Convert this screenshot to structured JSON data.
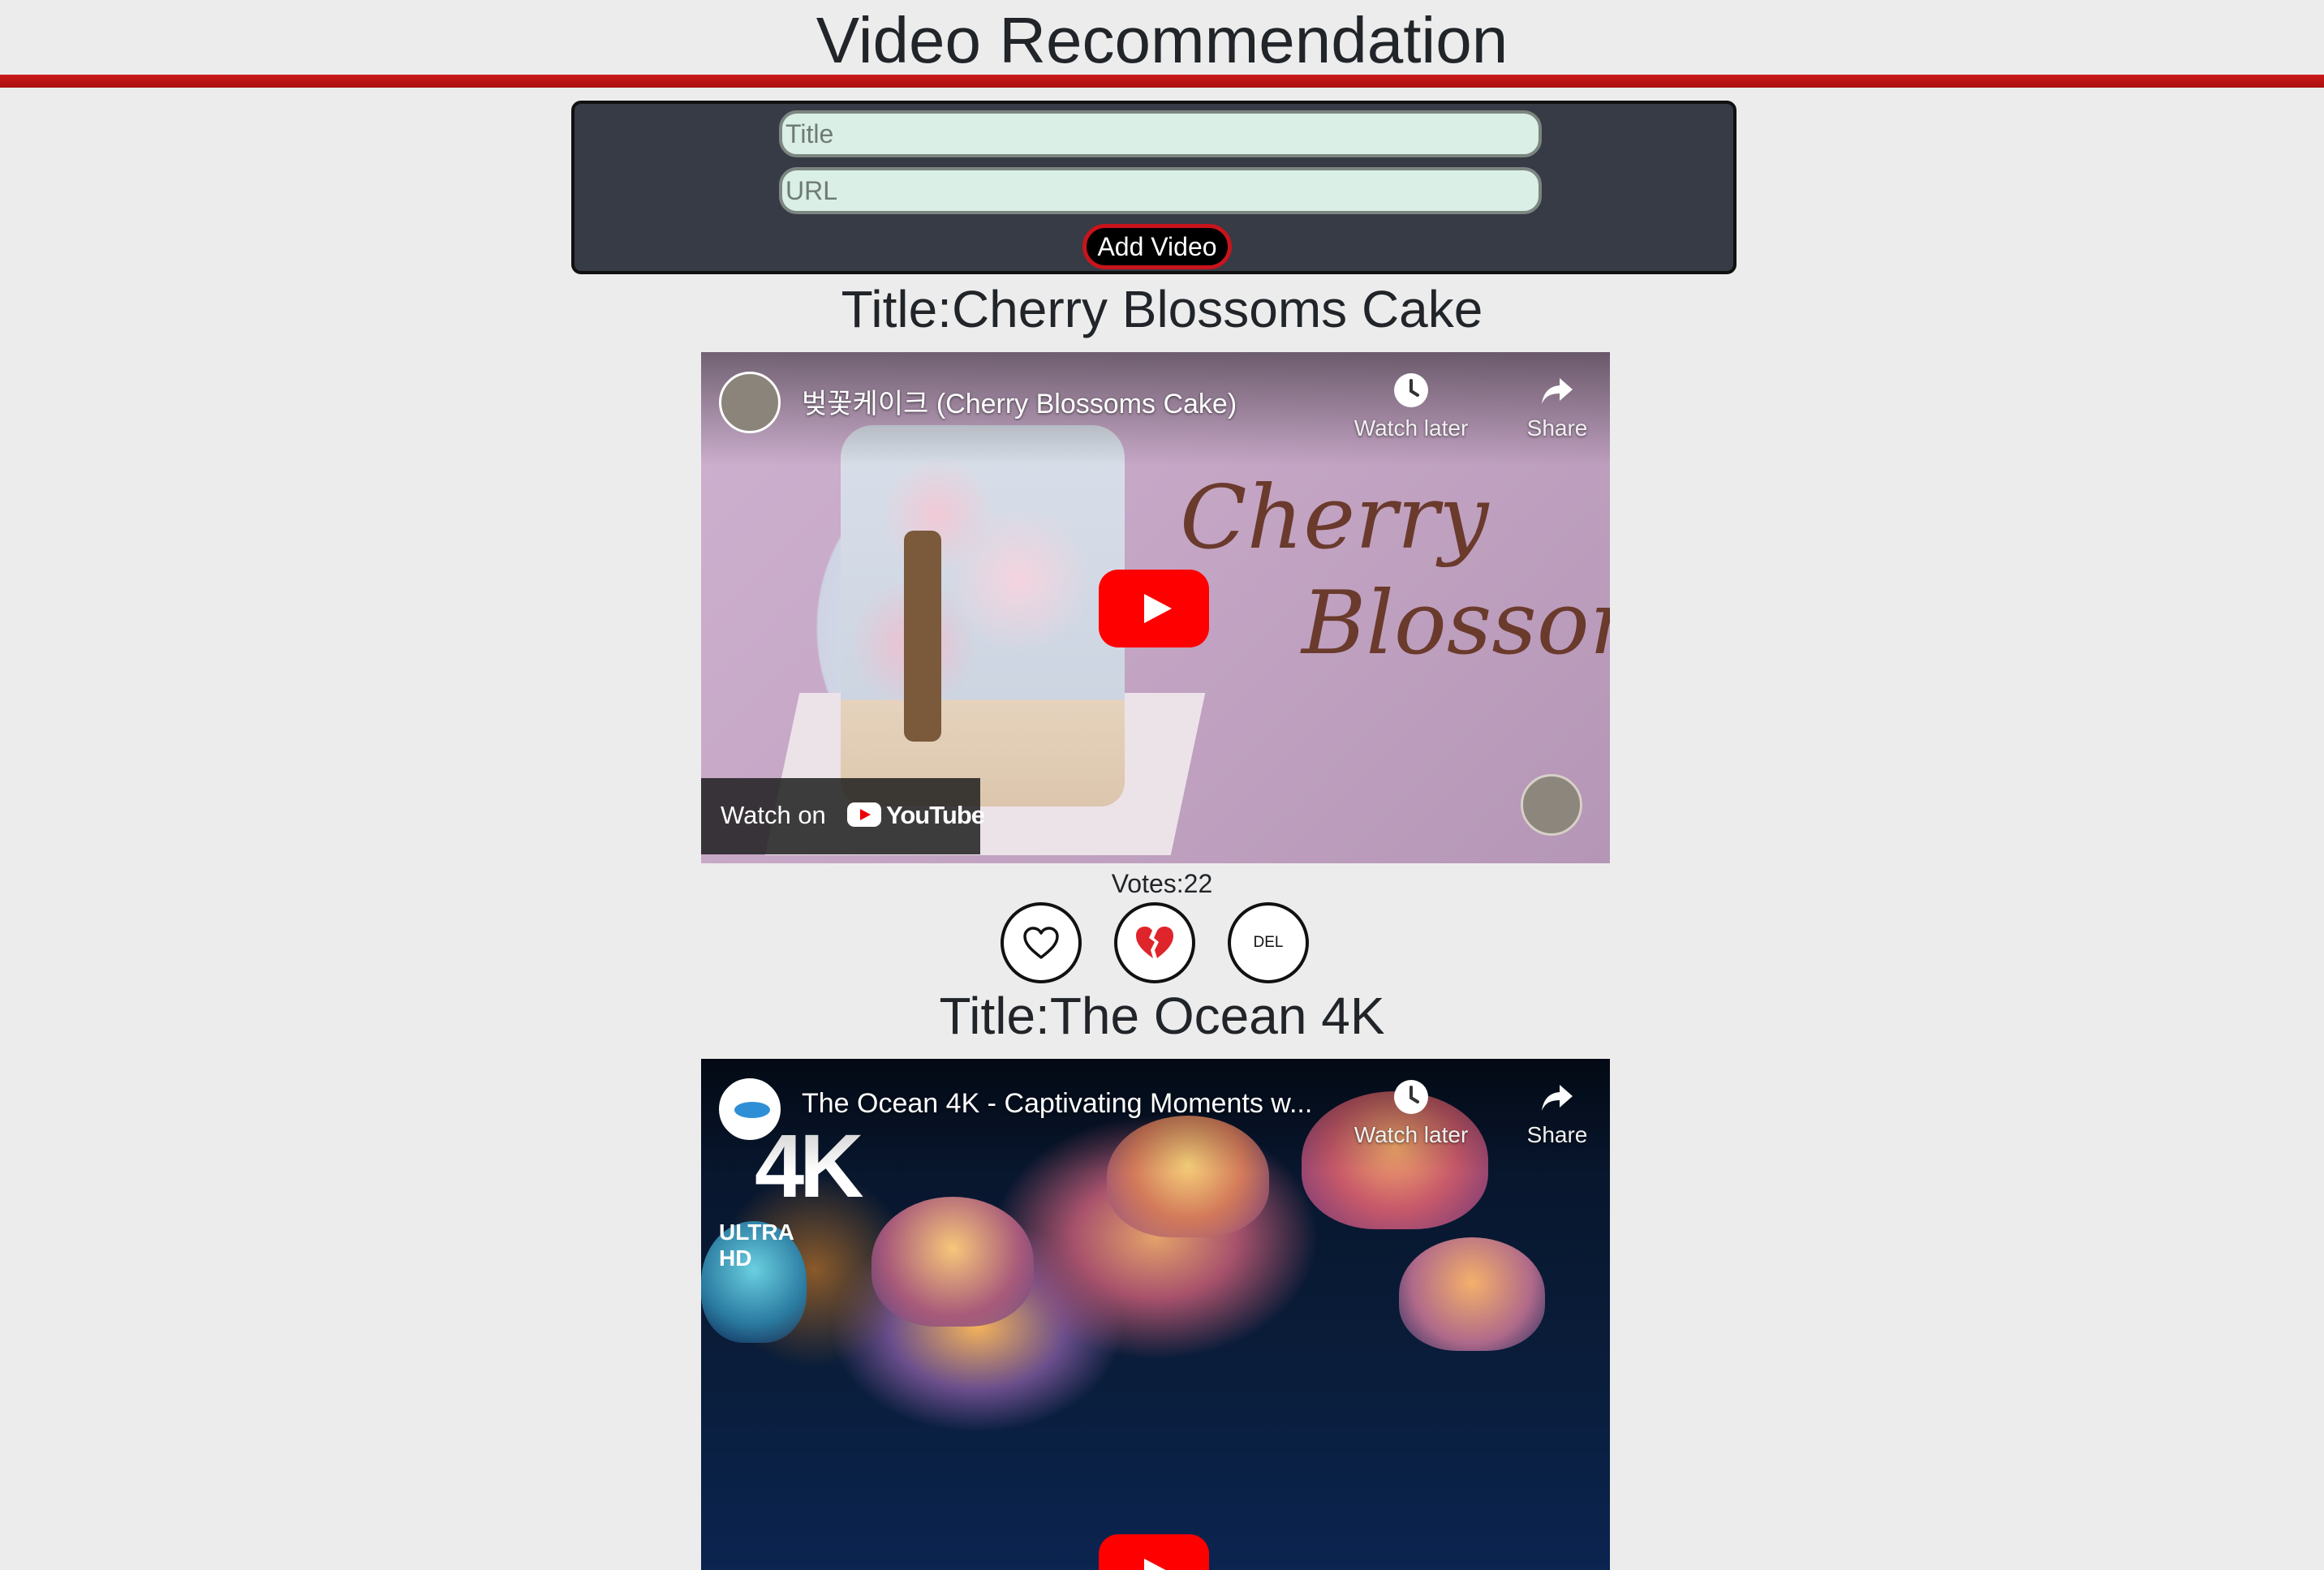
{
  "header": {
    "title": "Video Recommendation"
  },
  "form": {
    "title_placeholder": "Title",
    "url_placeholder": "URL",
    "add_label": "Add Video"
  },
  "videos": [
    {
      "heading": "Title:Cherry Blossoms Cake",
      "player": {
        "caption": "벚꽃케이크 (Cherry Blossoms Cake)",
        "watch_later": "Watch later",
        "share": "Share",
        "watch_on": "Watch on",
        "youtube": "YouTube",
        "overlay_line1": "Cherry",
        "overlay_line2": "Blossom"
      },
      "votes_text": "Votes:22",
      "delete_label": "DEL",
      "like_icon": "heart-icon",
      "dislike_icon": "broken-heart-icon"
    },
    {
      "heading": "Title:The Ocean 4K",
      "player": {
        "caption": "The Ocean 4K - Captivating Moments w...",
        "watch_later": "Watch later",
        "share": "Share",
        "badge_4k": "4K",
        "badge_ultra": "ULTRA HD"
      }
    }
  ],
  "colors": {
    "accent_red": "#c8141c",
    "form_bg": "#363b45",
    "input_bg": "#daefe6",
    "page_bg": "#ececec"
  }
}
